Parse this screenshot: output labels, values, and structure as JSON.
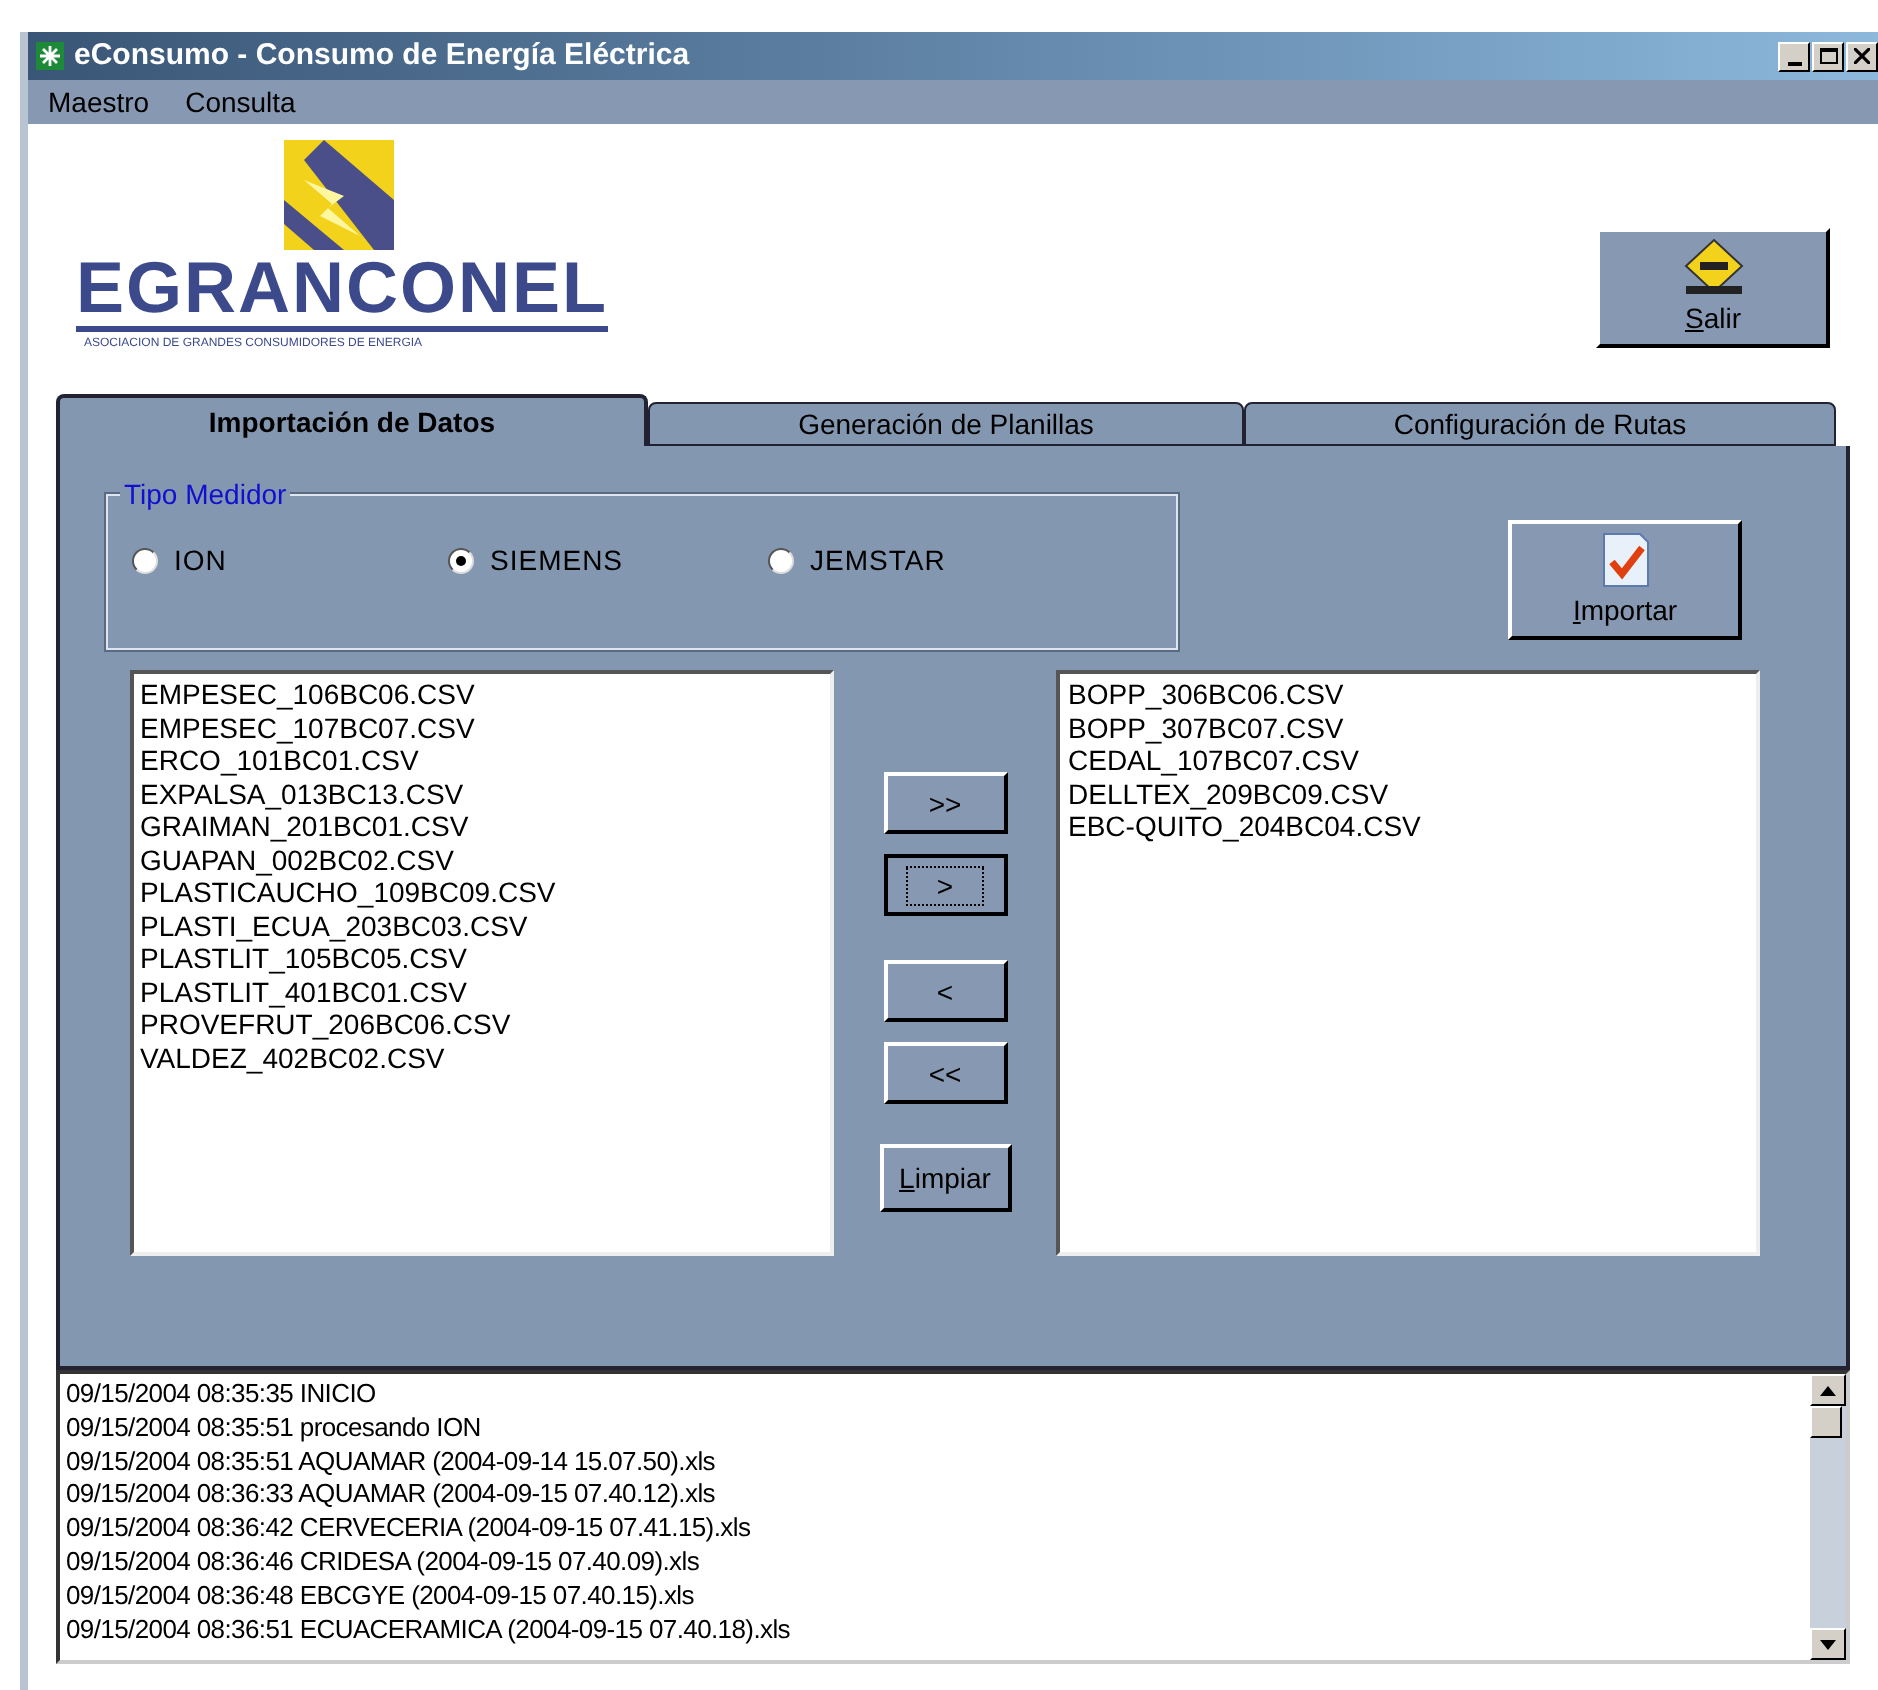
{
  "window": {
    "title": "eConsumo -  Consumo de Energía Eléctrica"
  },
  "menu": [
    "Maestro",
    "Consulta"
  ],
  "logo": {
    "name": "EGRANCONEL",
    "tagline": "ASOCIACION DE GRANDES CONSUMIDORES DE ENERGIA"
  },
  "exit_button": {
    "label": "Salir",
    "underline_first": true
  },
  "tabs": [
    {
      "label": "Importación de Datos",
      "selected": true
    },
    {
      "label": "Generación de Planillas",
      "selected": false
    },
    {
      "label": "Configuración de Rutas",
      "selected": false
    }
  ],
  "meter_type": {
    "title": "Tipo Medidor",
    "options": [
      {
        "label": "ION",
        "selected": false
      },
      {
        "label": "SIEMENS",
        "selected": true
      },
      {
        "label": "JEMSTAR",
        "selected": false
      }
    ]
  },
  "import_button": {
    "label": "Importar",
    "underline_first": true
  },
  "available_files": [
    "EMPESEC_106BC06.CSV",
    "EMPESEC_107BC07.CSV",
    "ERCO_101BC01.CSV",
    "EXPALSA_013BC13.CSV",
    "GRAIMAN_201BC01.CSV",
    "GUAPAN_002BC02.CSV",
    "PLASTICAUCHO_109BC09.CSV",
    "PLASTI_ECUA_203BC03.CSV",
    "PLASTLIT_105BC05.CSV",
    "PLASTLIT_401BC01.CSV",
    "PROVEFRUT_206BC06.CSV",
    "VALDEZ_402BC02.CSV"
  ],
  "move_buttons": [
    {
      "label": ">>",
      "focused": false
    },
    {
      "label": ">",
      "focused": true
    },
    {
      "label": "<",
      "focused": false
    },
    {
      "label": "<<",
      "focused": false
    }
  ],
  "clear_button": {
    "label": "Limpiar",
    "underline_first": true
  },
  "selected_files": [
    "BOPP_306BC06.CSV",
    "BOPP_307BC07.CSV",
    "CEDAL_107BC07.CSV",
    "DELLTEX_209BC09.CSV",
    "EBC-QUITO_204BC04.CSV"
  ],
  "log": [
    "09/15/2004 08:35:35 INICIO",
    "09/15/2004 08:35:51 procesando ION",
    "09/15/2004 08:35:51 AQUAMAR (2004-09-14 15.07.50).xls",
    "09/15/2004 08:36:33 AQUAMAR (2004-09-15 07.40.12).xls",
    "09/15/2004 08:36:42 CERVECERIA (2004-09-15 07.41.15).xls",
    "09/15/2004 08:36:46 CRIDESA (2004-09-15 07.40.09).xls",
    "09/15/2004 08:36:48 EBCGYE (2004-09-15 07.40.15).xls",
    "09/15/2004 08:36:51 ECUACERAMICA (2004-09-15 07.40.18).xls"
  ]
}
